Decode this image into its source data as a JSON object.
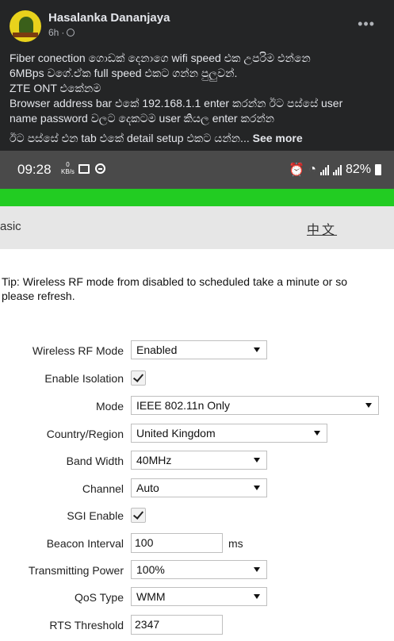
{
  "post": {
    "author": "Hasalanka Dananjaya",
    "time": "6h",
    "more_icon": "more-horizontal-icon",
    "line1": "Fiber conection ගොඩක් දෙනාගෙ wifi speed එක උපරිම එන්නෙ",
    "line2": "6MBps වගේ.ඒක full speed එකට ගන්න පුලුවන්.",
    "line3": "ZTE ONT එකේනම",
    "line4": "Browser address bar එකේ 192.168.1.1 enter කරන්න ඊට පස්සේ user",
    "line5": "name password වලට දෙකටම user කියල enter කරන්න",
    "line6": "ඊට පස්සේ එන tab එකේ detail setup එකට යන්න...",
    "see_more": "See more"
  },
  "status_bar": {
    "time": "09:28",
    "net_speed_value": "0",
    "net_speed_unit": "KB/s",
    "battery": "82%",
    "icons": [
      "image-icon",
      "dnd-icon",
      "alarm-icon",
      "wifi-icon",
      "signal-icon",
      "battery-icon"
    ]
  },
  "router": {
    "tab_label": "asic",
    "lang_link": "中文",
    "tip_line1": "Tip: Wireless RF mode from disabled to scheduled take a minute or so",
    "tip_line2": "please refresh.",
    "fields": {
      "wireless_rf_mode": {
        "label": "Wireless RF Mode",
        "value": "Enabled"
      },
      "enable_isolation": {
        "label": "Enable Isolation",
        "checked": true
      },
      "mode": {
        "label": "Mode",
        "value": "IEEE 802.11n Only"
      },
      "country": {
        "label": "Country/Region",
        "value": "United Kingdom"
      },
      "band_width": {
        "label": "Band Width",
        "value": "40MHz"
      },
      "channel": {
        "label": "Channel",
        "value": "Auto"
      },
      "sgi_enable": {
        "label": "SGI Enable",
        "checked": true
      },
      "beacon_interval": {
        "label": "Beacon Interval",
        "value": "100",
        "unit": "ms"
      },
      "tx_power": {
        "label": "Transmitting Power",
        "value": "100%"
      },
      "qos_type": {
        "label": "QoS Type",
        "value": "WMM"
      },
      "rts_threshold": {
        "label": "RTS Threshold",
        "value": "2347"
      }
    }
  },
  "colors": {
    "post_bg": "#242526",
    "status_bg": "#4a4a4a",
    "accent_green": "#22cc22"
  }
}
